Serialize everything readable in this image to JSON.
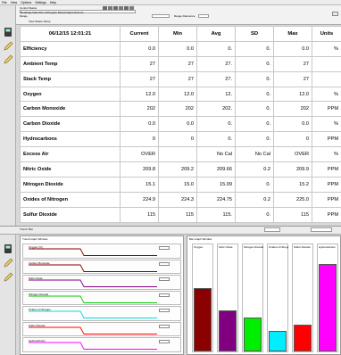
{
  "menu": [
    "File",
    "View",
    "Options",
    "Settings",
    "Help"
  ],
  "toolbar": {
    "row1": "Control  Status",
    "row2": "Readings  Data File  c:\\Program Files\\Analyzer\\test.txt",
    "row3": "Range",
    "row4": "View   Status   Setup",
    "field_right": "Range Reference"
  },
  "table": {
    "timestamp": "06/12/15 12:01:21",
    "headers": [
      "Current",
      "Min",
      "Avg",
      "SD",
      "Max",
      "Units"
    ],
    "rows": [
      {
        "name": "Efficiency",
        "current": "0.0",
        "min": "0.0",
        "avg": "0.",
        "sd": "0.",
        "max": "0.0",
        "units": "%"
      },
      {
        "name": "Ambient Temp",
        "current": "27",
        "min": "27",
        "avg": "27.",
        "sd": "0.",
        "max": "27",
        "units": ""
      },
      {
        "name": "Stack Temp",
        "current": "27",
        "min": "27",
        "avg": "27.",
        "sd": "0.",
        "max": "27",
        "units": ""
      },
      {
        "name": "Oxygen",
        "current": "12.0",
        "min": "12.0",
        "avg": "12.",
        "sd": "0.",
        "max": "12.0",
        "units": "%"
      },
      {
        "name": "Carbon Monoxide",
        "current": "202",
        "min": "202",
        "avg": "202.",
        "sd": "0.",
        "max": "202",
        "units": "PPM"
      },
      {
        "name": "Carbon Dioxide",
        "current": "0.0",
        "min": "0.0",
        "avg": "0.",
        "sd": "0.",
        "max": "0.0",
        "units": "%"
      },
      {
        "name": "Hydrocarbons",
        "current": "0",
        "min": "0",
        "avg": "0.",
        "sd": "0.",
        "max": "0",
        "units": "PPM"
      },
      {
        "name": "Excess Air",
        "current": "OVER",
        "min": "",
        "avg": "No Cal",
        "sd": "No Cal",
        "max": "OVER",
        "units": "%"
      },
      {
        "name": "Nitric Oxide",
        "current": "209.8",
        "min": "209.2",
        "avg": "209.66",
        "sd": "0.2",
        "max": "209.9",
        "units": "PPM"
      },
      {
        "name": "Nitrogen Dioxide",
        "current": "15.1",
        "min": "15.0",
        "avg": "15.09",
        "sd": "0.",
        "max": "15.2",
        "units": "PPM"
      },
      {
        "name": "Oxides of Nitrogen",
        "current": "224.9",
        "min": "224.3",
        "avg": "224.75",
        "sd": "0.2",
        "max": "225.0",
        "units": "PPM"
      },
      {
        "name": "Sulfur Dioxide",
        "current": "115",
        "min": "115",
        "avg": "115.",
        "sd": "0.",
        "max": "115",
        "units": "PPM"
      }
    ]
  },
  "bottom": {
    "tab": "Trend / Bar",
    "trend_title": "Trend  Graph  Window",
    "bar_title": "Bar  Graph  Window"
  },
  "trends": [
    {
      "label": "Oxygen (%)",
      "color": "#8b0000"
    },
    {
      "label": "Carbon Monoxide",
      "color": "#8b0000"
    },
    {
      "label": "Nitric Oxide",
      "color": "#800080"
    },
    {
      "label": "Nitrogen Dioxide",
      "color": "#00cc00"
    },
    {
      "label": "Oxides of Nitrogen",
      "color": "#00dddd"
    },
    {
      "label": "Sulfur Dioxide",
      "color": "#ff0000"
    },
    {
      "label": "Hydrocarbons",
      "color": "#ff00ff"
    }
  ],
  "bars": [
    {
      "label": "Oxygen",
      "color": "#8b0000",
      "level": 0.62
    },
    {
      "label": "Nitric Oxide",
      "color": "#800080",
      "level": 0.4
    },
    {
      "label": "Nitrogen Dioxide",
      "color": "#00ee00",
      "level": 0.33
    },
    {
      "label": "Oxides of Nitrogen",
      "color": "#00eeff",
      "level": 0.2
    },
    {
      "label": "Sulfur Dioxide",
      "color": "#ff0000",
      "level": 0.26
    },
    {
      "label": "Hydrocarbons",
      "color": "#ff00ff",
      "level": 0.86
    }
  ]
}
